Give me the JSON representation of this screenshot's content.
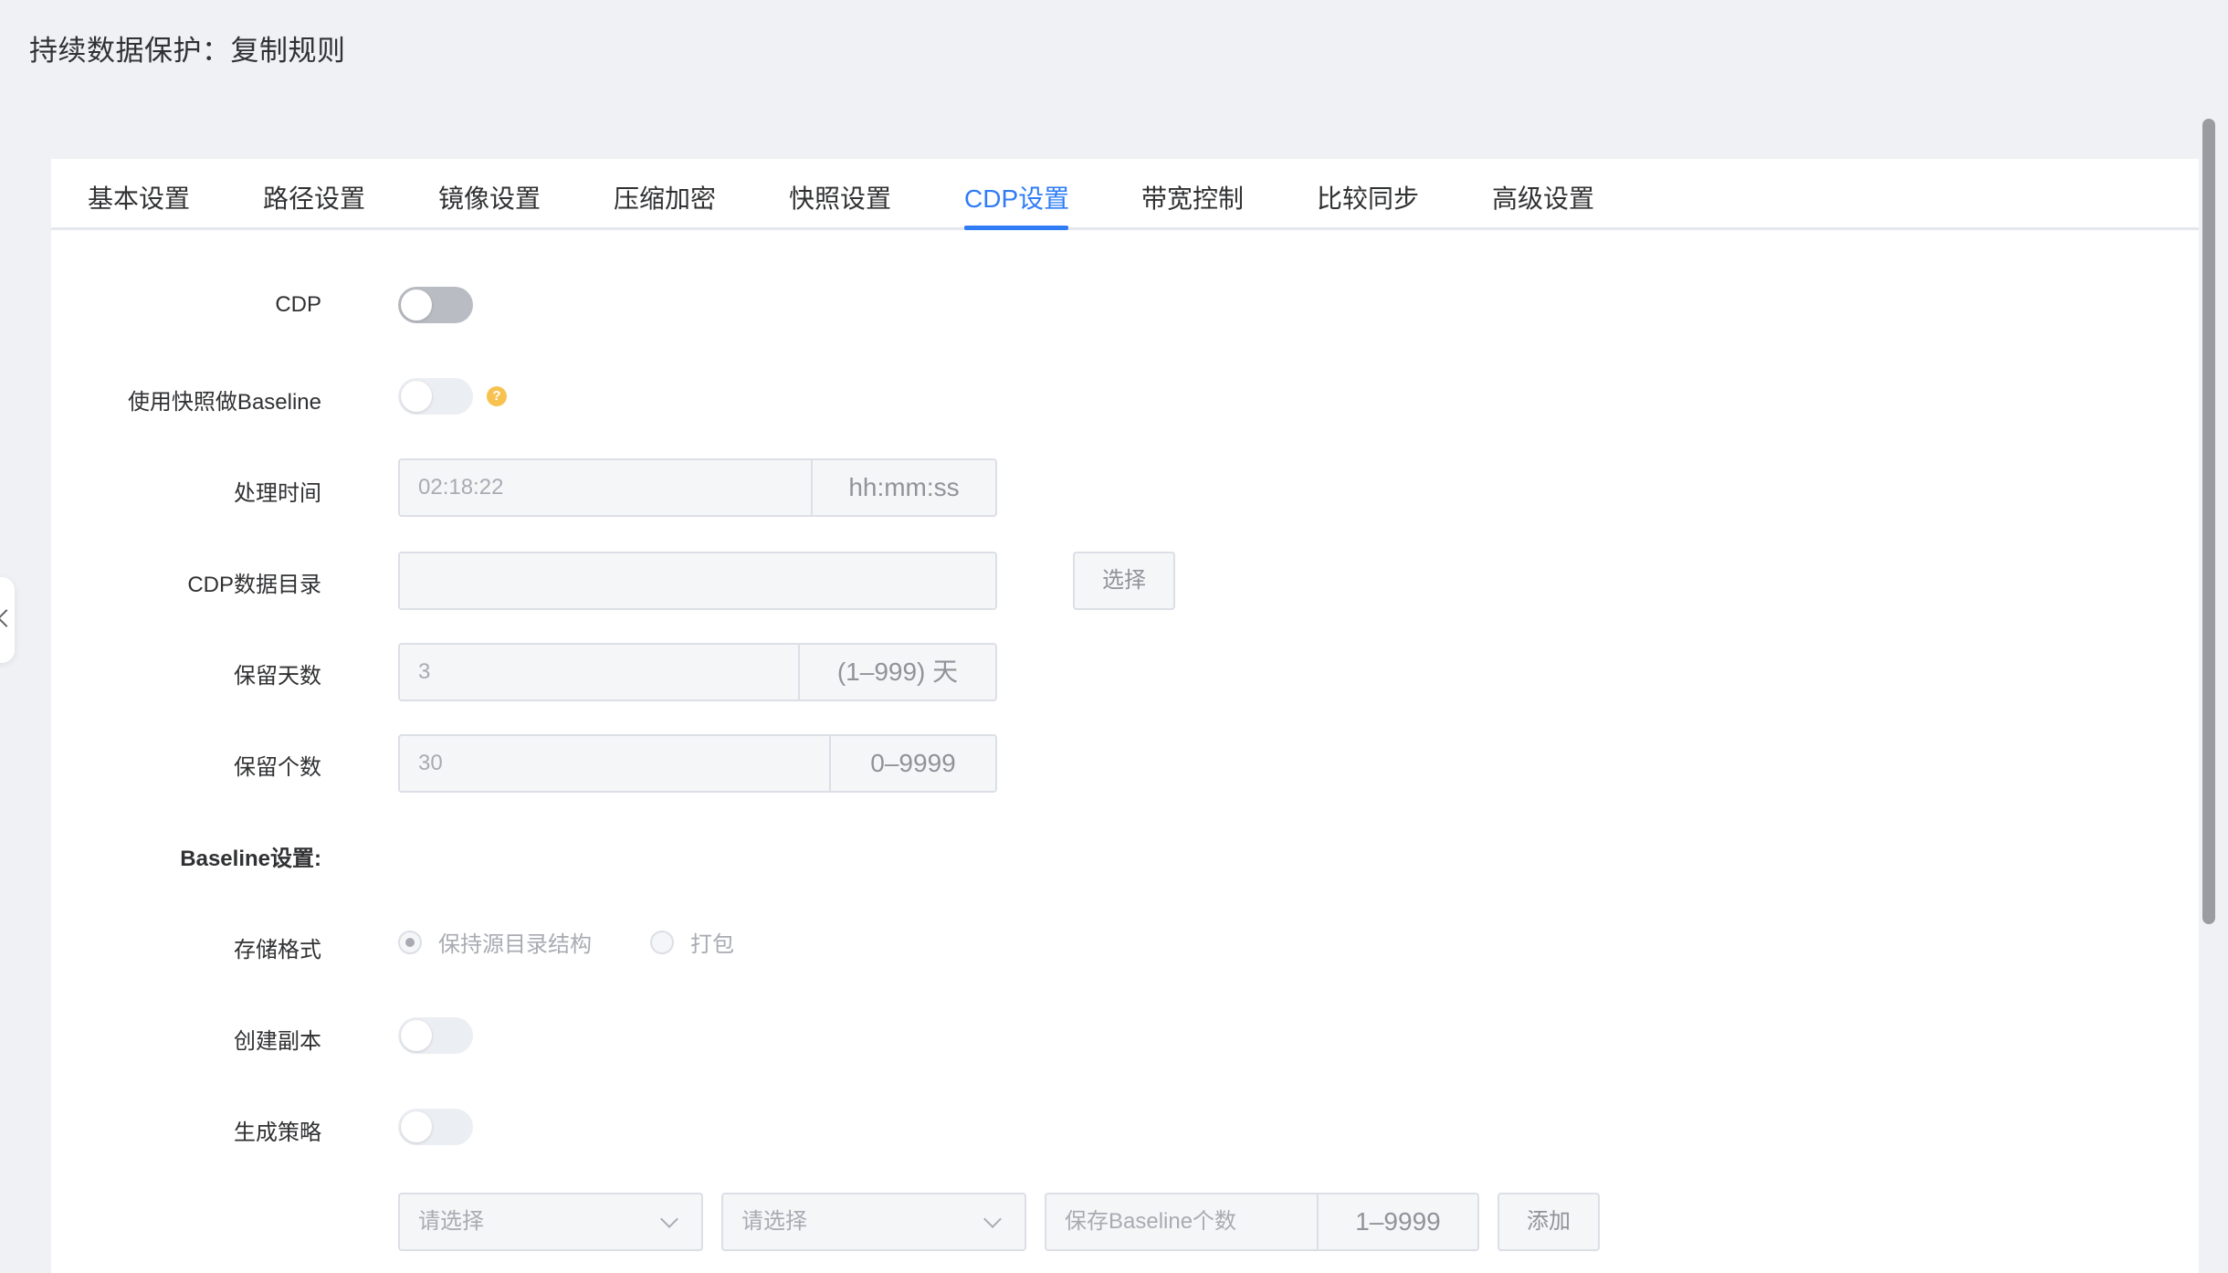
{
  "page_title": "持续数据保护：复制规则",
  "tabs": [
    {
      "label": "基本设置"
    },
    {
      "label": "路径设置"
    },
    {
      "label": "镜像设置"
    },
    {
      "label": "压缩加密"
    },
    {
      "label": "快照设置"
    },
    {
      "label": "CDP设置",
      "active": true
    },
    {
      "label": "带宽控制"
    },
    {
      "label": "比较同步"
    },
    {
      "label": "高级设置"
    }
  ],
  "form": {
    "cdp_label": "CDP",
    "snapshot_baseline_label": "使用快照做Baseline",
    "help_icon": "?",
    "process_time": {
      "label": "处理时间",
      "value": "02:18:22",
      "suffix": "hh:mm:ss"
    },
    "cdp_dir": {
      "label": "CDP数据目录",
      "value": "",
      "button": "选择"
    },
    "retain_days": {
      "label": "保留天数",
      "value": "3",
      "suffix": "(1–999) 天"
    },
    "retain_count": {
      "label": "保留个数",
      "value": "30",
      "suffix": "0–9999"
    },
    "baseline_section": "Baseline设置:",
    "storage_format": {
      "label": "存储格式",
      "option1": "保持源目录结构",
      "option2": "打包"
    },
    "create_copy_label": "创建副本",
    "gen_policy_label": "生成策略",
    "policy_row": {
      "select1_placeholder": "请选择",
      "select2_placeholder": "请选择",
      "baseline_count_placeholder": "保存Baseline个数",
      "baseline_count_suffix": "1–9999",
      "add_button": "添加"
    }
  },
  "toggles": {
    "cdp": false,
    "snapshot_baseline": false,
    "create_copy": false,
    "gen_policy": false
  },
  "colors": {
    "accent": "#2f7cf6",
    "help": "#f7c250",
    "background": "#f0f1f4"
  }
}
